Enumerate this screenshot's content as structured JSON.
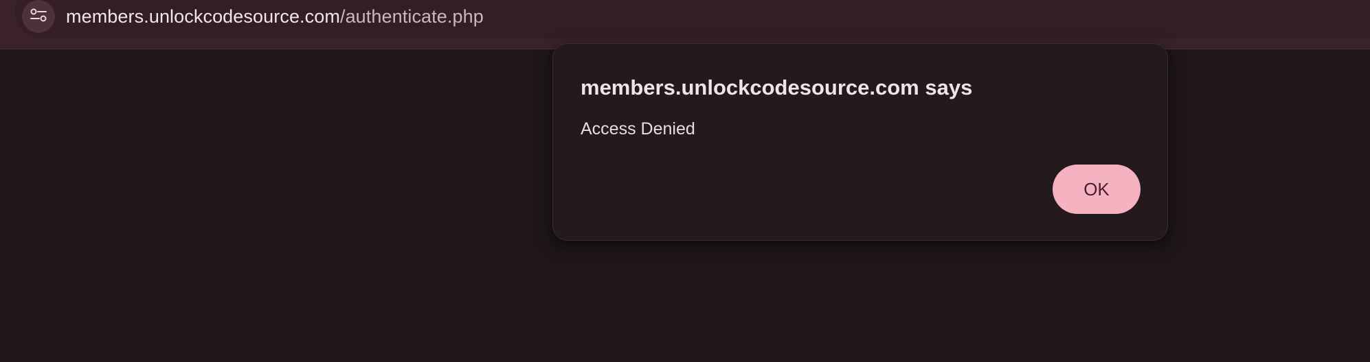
{
  "browser": {
    "url_host": "members.unlockcodesource.com",
    "url_path": "/authenticate.php",
    "site_info_icon": "tune-icon"
  },
  "dialog": {
    "title": "members.unlockcodesource.com says",
    "message": "Access Denied",
    "ok_label": "OK"
  },
  "colors": {
    "page_background": "#1e1617",
    "toolbar": "#3a2228",
    "dialog_background": "#241a1e",
    "ok_button": "#f5b3c2"
  }
}
